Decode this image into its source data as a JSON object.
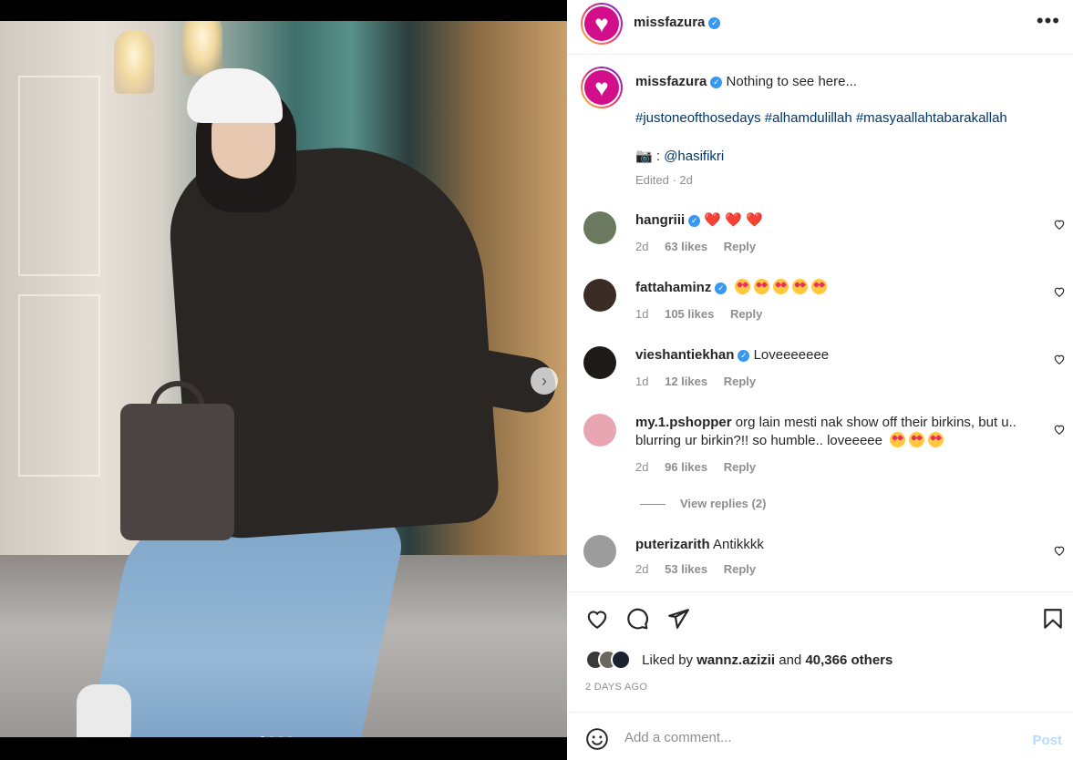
{
  "post": {
    "username": "missfazura",
    "verified": true,
    "caption": "Nothing to see here...",
    "hashtags": "#justoneofthosedays #alhamdulillah #masyaallahtabarakallah",
    "photo_credit_prefix": "📷 : ",
    "photo_credit_mention": "@hasifikri",
    "edited_meta": "Edited · 2d",
    "carousel": {
      "count": 4,
      "active_index": 0
    }
  },
  "comments": [
    {
      "username": "hangriii",
      "verified": true,
      "text": "❤️ ❤️ ❤️",
      "emoji": "hearts",
      "time": "2d",
      "likes": "63 likes",
      "reply": "Reply",
      "avatar_color": "#6b7a5e"
    },
    {
      "username": "fattahaminz",
      "verified": true,
      "text": "",
      "emoji": "heart-eyes-5",
      "time": "1d",
      "likes": "105 likes",
      "reply": "Reply",
      "avatar_color": "#3b2c25"
    },
    {
      "username": "vieshantiekhan",
      "verified": true,
      "text": "Loveeeeeee",
      "emoji": "",
      "time": "1d",
      "likes": "12 likes",
      "reply": "Reply",
      "avatar_color": "#1f1a1a"
    },
    {
      "username": "my.1.pshopper",
      "verified": false,
      "text": "org lain mesti nak show off their birkins, but u.. blurring ur birkin?!! so humble.. loveeeee",
      "emoji": "heart-eyes-3",
      "time": "2d",
      "likes": "96 likes",
      "reply": "Reply",
      "avatar_color": "#e9a6b2"
    },
    {
      "username": "puterizarith",
      "verified": false,
      "text": "Antikkkk",
      "emoji": "",
      "time": "2d",
      "likes": "53 likes",
      "reply": "Reply",
      "avatar_color": "#9c9c9c"
    }
  ],
  "view_replies": "View replies (2)",
  "likes": {
    "prefix": "Liked by ",
    "user": "wannz.azizii",
    "middle": " and ",
    "others": "40,366 others"
  },
  "date": "2 DAYS AGO",
  "add_comment": {
    "placeholder": "Add a comment...",
    "post_label": "Post"
  },
  "icons": {
    "more": "more-horizontal-icon",
    "like": "heart-outline-icon",
    "comment": "comment-bubble-icon",
    "share": "paper-plane-icon",
    "save": "bookmark-icon",
    "emoji": "smiley-icon",
    "next": "chevron-right-icon"
  },
  "colors": {
    "link": "#00376b",
    "verified": "#3897f0",
    "muted": "#8e8e8e",
    "post_disabled": "#b3dbff"
  }
}
